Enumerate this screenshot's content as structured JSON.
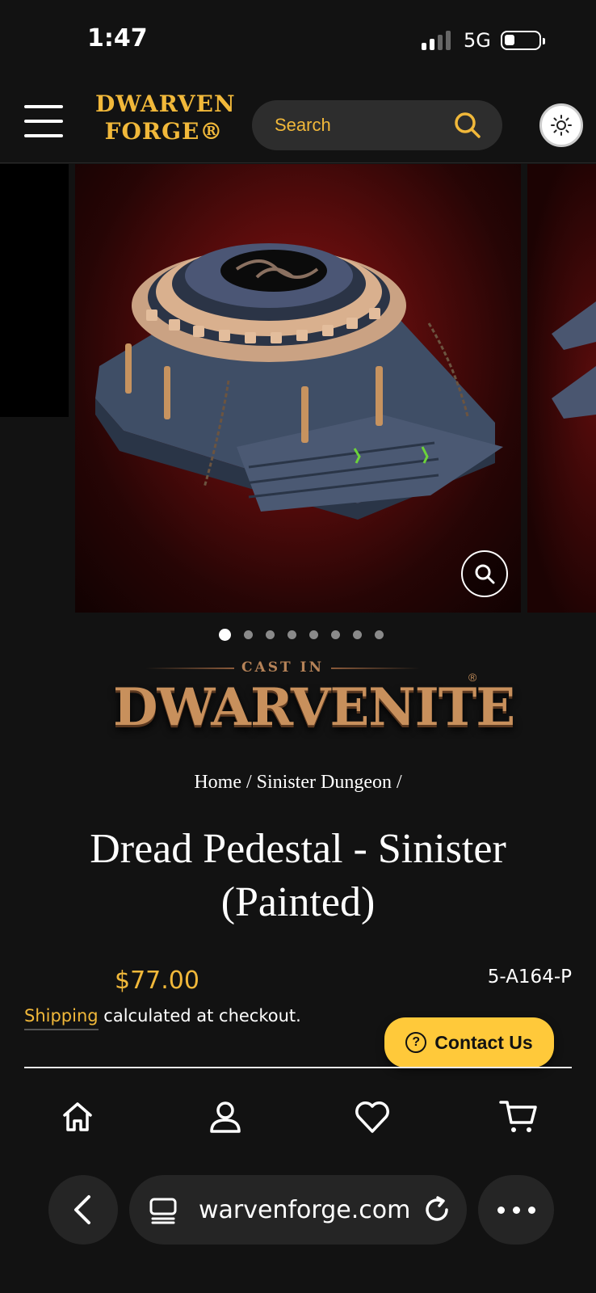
{
  "status_bar": {
    "time": "1:47",
    "network": "5G"
  },
  "header": {
    "logo_line1": "DWARVEN",
    "logo_line2": "FORGE®",
    "search_placeholder": "Search"
  },
  "gallery": {
    "slide_count": 8,
    "active_index": 0
  },
  "badge": {
    "cast_in": "CAST IN",
    "brand": "DWARVENITE",
    "reg": "®"
  },
  "breadcrumb": {
    "home": "Home",
    "category": "Sinister Dungeon",
    "sep": "/"
  },
  "product": {
    "title": "Dread Pedestal - Sinister (Painted)",
    "price": "$77.00",
    "sku": "5-A164-P",
    "shipping_link": "Shipping",
    "shipping_text": " calculated at checkout."
  },
  "contact": {
    "label": "Contact Us",
    "icon": "?"
  },
  "tabbar": {
    "items": [
      "home-icon",
      "account-icon",
      "wishlist-icon",
      "cart-icon"
    ]
  },
  "browser": {
    "url": "warvenforge.com"
  },
  "colors": {
    "accent": "#f1b83a",
    "background": "#121212",
    "contact_bg": "#ffc93a"
  }
}
